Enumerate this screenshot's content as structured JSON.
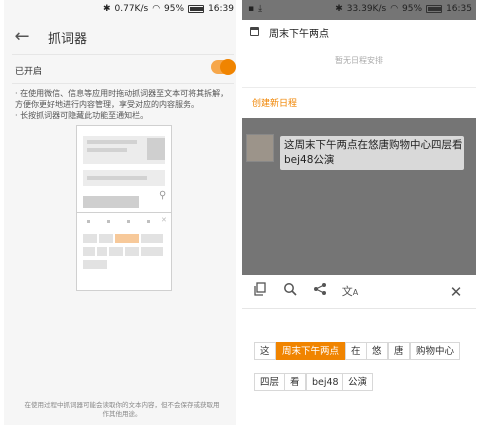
{
  "left": {
    "status": {
      "speed": "0.77K/s",
      "battery": "95%",
      "time": "16:39"
    },
    "title": "抓词器",
    "toggle": {
      "label": "已开启",
      "on": true
    },
    "description": [
      "· 在使用微信、信息等应用时拖动抓词器至文本可将其拆解，方便你更好地进行内容管理，享受对应的内容服务。",
      "· 长按抓词器可隐藏此功能至通知栏。"
    ],
    "footnote": "在使用过程中抓词器可能会读取你的文本内容，但不会保存或获取用作其他用途。",
    "colors": {
      "accent": "#f08400",
      "background": "#f6f6f6"
    }
  },
  "right": {
    "status": {
      "speed": "33.39K/s",
      "battery": "95%",
      "time": "16:35"
    },
    "calendar": {
      "title": "周末下午两点",
      "empty_text": "暂无日程安排",
      "create_label": "创建新日程"
    },
    "message": "这周末下午两点在悠唐购物中心四层看bej48公演",
    "toolbar_icons": [
      "copy-icon",
      "search-icon",
      "share-icon",
      "translate-icon",
      "close-icon"
    ],
    "chips_row1": [
      "这",
      "周末下午两点",
      "在",
      "悠",
      "唐",
      "购物中心"
    ],
    "chips_row2": [
      "四层",
      "看",
      "bej48",
      "公演"
    ],
    "selected_chip": "周末下午两点"
  }
}
